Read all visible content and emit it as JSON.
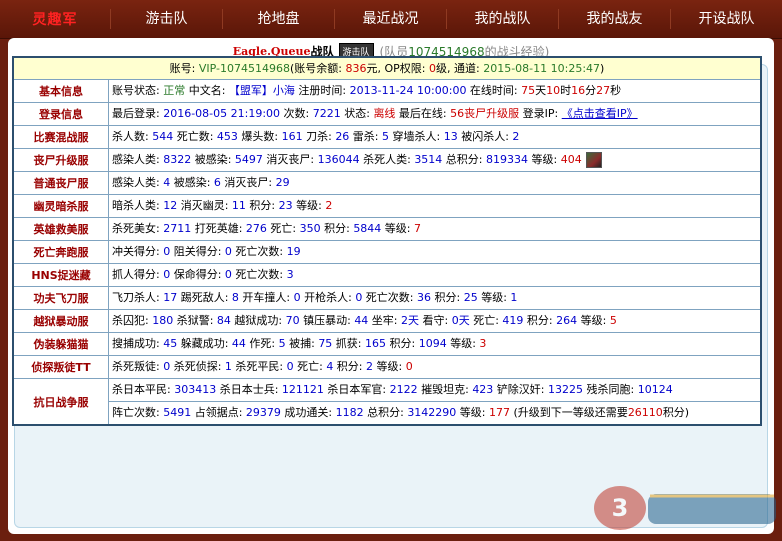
{
  "nav": {
    "logo": "灵趣军",
    "items": [
      "游击队",
      "抢地盘",
      "最近战况",
      "我的战队",
      "我的战友",
      "开设战队"
    ]
  },
  "team": {
    "name": "Eagle.Queue",
    "suffix": "战队",
    "badge": "游击队",
    "member_prefix": "(队员",
    "member_id": "1074514968",
    "member_suffix": "的战斗经验)"
  },
  "account": {
    "p1": "账号: ",
    "id": "VIP-1074514968",
    "p2": "(账号余额: ",
    "balance": "836",
    "p3": "元, OP权限: ",
    "op": "0",
    "p4": "级, 通道: ",
    "date": "2015-08-11 10:25:47",
    "p5": ")"
  },
  "basic": {
    "label": "基本信息",
    "t1": "账号状态: ",
    "status": "正常",
    "t2": " 中文名: ",
    "cn_tag": "【盟军】",
    "cn_name": "小海",
    "t3": " 注册时间: ",
    "reg": "2013-11-24 10:00:00",
    "t4": " 在线时间: ",
    "d": "75",
    "t5": "天",
    "h": "10",
    "t6": "时",
    "m": "16",
    "t7": "分",
    "s": "27",
    "t8": "秒"
  },
  "login": {
    "label": "登录信息",
    "t1": "最后登录: ",
    "last": "2016-08-05 21:19:00",
    "t2": " 次数: ",
    "count": "7221",
    "t3": " 状态: ",
    "state": "离线",
    "t4": " 最后在线: ",
    "server": "56丧尸升级服",
    "t5": " 登录IP: ",
    "ip": "《点击查看IP》"
  },
  "rows": {
    "r1": {
      "label": "比赛混战服",
      "t1": "杀人数: ",
      "a": "544",
      "t2": " 死亡数: ",
      "b": "453",
      "t3": " 爆头数: ",
      "c": "161",
      "t4": " 刀杀: ",
      "d": "26",
      "t5": " 雷杀: ",
      "e": "5",
      "t6": " 穿墙杀人: ",
      "f": "13",
      "t7": " 被闪杀人: ",
      "g": "2"
    },
    "r2": {
      "label": "丧尸升级服",
      "t1": "感染人类: ",
      "a": "8322",
      "t2": " 被感染: ",
      "b": "5497",
      "t3": " 消灭丧尸: ",
      "c": "136044",
      "t4": " 杀死人类: ",
      "d": "3514",
      "t5": " 总积分: ",
      "e": "819334",
      "t6": " 等级: ",
      "f": "404"
    },
    "r3": {
      "label": "普通丧尸服",
      "t1": "感染人类: ",
      "a": "4",
      "t2": " 被感染: ",
      "b": "6",
      "t3": " 消灭丧尸: ",
      "c": "29"
    },
    "r4": {
      "label": "幽灵暗杀服",
      "t1": "暗杀人类: ",
      "a": "12",
      "t2": " 消灭幽灵: ",
      "b": "11",
      "t3": " 积分: ",
      "c": "23",
      "t4": " 等级: ",
      "d": "2"
    },
    "r5": {
      "label": "英雄救美服",
      "t1": "杀死美女: ",
      "a": "2711",
      "t2": " 打死英雄: ",
      "b": "276",
      "t3": " 死亡: ",
      "c": "350",
      "t4": " 积分: ",
      "d": "5844",
      "t5": " 等级: ",
      "e": "7"
    },
    "r6": {
      "label": "死亡奔跑服",
      "t1": "冲关得分: ",
      "a": "0",
      "t2": " 阻关得分: ",
      "b": "0",
      "t3": " 死亡次数: ",
      "c": "19"
    },
    "r7": {
      "label": "HNS捉迷藏",
      "t1": "抓人得分: ",
      "a": "0",
      "t2": " 保命得分: ",
      "b": "0",
      "t3": " 死亡次数: ",
      "c": "3"
    },
    "r8": {
      "label": "功夫飞刀服",
      "t1": "飞刀杀人: ",
      "a": "17",
      "t2": " 踢死敌人: ",
      "b": "8",
      "t3": " 开车撞人: ",
      "c": "0",
      "t4": " 开枪杀人: ",
      "d": "0",
      "t5": " 死亡次数: ",
      "e": "36",
      "t6": " 积分: ",
      "f": "25",
      "t7": " 等级: ",
      "g": "1"
    },
    "r9": {
      "label": "越狱暴动服",
      "t1": "杀囚犯: ",
      "a": "180",
      "t2": " 杀狱警: ",
      "b": "84",
      "t3": " 越狱成功: ",
      "c": "70",
      "t4": " 镇压暴动: ",
      "d": "44",
      "t5": " 坐牢: ",
      "e": "2天",
      "t6": " 看守: ",
      "f": "0天",
      "t7": " 死亡: ",
      "g": "419",
      "t8": " 积分: ",
      "h": "264",
      "t9": " 等级: ",
      "i": "5"
    },
    "r10": {
      "label": "伪装躲猫猫",
      "t1": "搜捕成功: ",
      "a": "45",
      "t2": " 躲藏成功: ",
      "b": "44",
      "t3": " 作死: ",
      "c": "5",
      "t4": " 被捕: ",
      "d": "75",
      "t5": " 抓获: ",
      "e": "165",
      "t6": " 积分: ",
      "f": "1094",
      "t7": " 等级: ",
      "g": "3"
    },
    "r11": {
      "label": "侦探叛徒TT",
      "t1": "杀死叛徒: ",
      "a": "0",
      "t2": " 杀死侦探: ",
      "b": "1",
      "t3": " 杀死平民: ",
      "c": "0",
      "t4": " 死亡: ",
      "d": "4",
      "t5": " 积分: ",
      "e": "2",
      "t6": " 等级: ",
      "f": "0"
    }
  },
  "anti": {
    "label": "抗日战争服",
    "l1": {
      "t1": "杀日本平民: ",
      "a": "303413",
      "t2": " 杀日本士兵: ",
      "b": "121121",
      "t3": " 杀日本军官: ",
      "c": "2122",
      "t4": " 摧毁坦克: ",
      "d": "423",
      "t5": " 铲除汉奸: ",
      "e": "13225",
      "t6": " 残杀同胞: ",
      "f": "10124"
    },
    "l2": {
      "t1": "阵亡次数: ",
      "a": "5491",
      "t2": " 占领据点: ",
      "b": "29379",
      "t3": " 成功通关: ",
      "c": "1182",
      "t4": " 总积分: ",
      "d": "3142290",
      "t5": " 等级: ",
      "e": "177",
      "t6": " (升级到下一等级还需要",
      "f": "26110",
      "t7": "积分)"
    }
  },
  "colors": {
    "nav_bg": "#6b1f0f",
    "label_red": "#990000",
    "value_blue": "#0000cc",
    "highlight_red": "#cc0000",
    "ok_green": "#2a7a2a",
    "account_bg": "#ffffd0"
  }
}
